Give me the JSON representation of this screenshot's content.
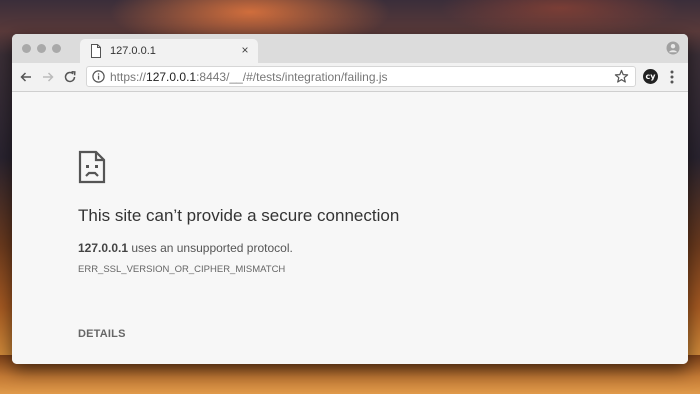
{
  "browser": {
    "tab": {
      "title": "127.0.0.1",
      "icon": "document-icon",
      "close_glyph": "×"
    },
    "address_bar": {
      "scheme": "https://",
      "host": "127.0.0.1",
      "rest": ":8443/__/#/tests/integration/failing.js"
    },
    "extension": {
      "label": "cy"
    },
    "icons": [
      "back-arrow-icon",
      "forward-arrow-icon",
      "reload-icon",
      "info-icon",
      "star-icon",
      "menu-icon",
      "profile-icon"
    ]
  },
  "error_page": {
    "icon": "sad-document-icon",
    "heading": "This site can’t provide a secure connection",
    "message_host": "127.0.0.1",
    "message_rest": " uses an unsupported protocol.",
    "error_code": "ERR_SSL_VERSION_OR_CIPHER_MISMATCH",
    "details_label": "DETAILS"
  },
  "colors": {
    "window_bg": "#f7f7f7",
    "titlebar": "#dcdcdc",
    "text_primary": "#333333"
  }
}
